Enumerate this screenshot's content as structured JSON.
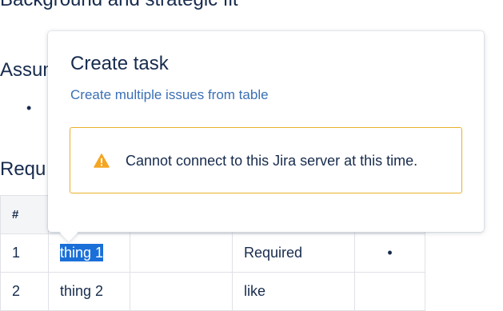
{
  "document": {
    "headings": {
      "background": "Background and strategic fit",
      "assumptions": "Assum",
      "requirements": "Requ"
    },
    "assumptions_bullet": "•",
    "table": {
      "header": [
        "#",
        "",
        "",
        "",
        ""
      ],
      "rows": [
        {
          "num": "1",
          "title": "thing 1",
          "col3": "",
          "priority": "Required",
          "notes": "•"
        },
        {
          "num": "2",
          "title": "thing 2",
          "col3": "",
          "priority": "like",
          "notes": ""
        }
      ]
    }
  },
  "popup": {
    "title": "Create task",
    "link": "Create multiple issues from table",
    "warning": {
      "icon": "warning-icon",
      "message": "Cannot connect to this Jira server at this time.",
      "border_color": "#e8b12b",
      "icon_color": "#f5a623"
    }
  },
  "colors": {
    "text": "#172b4d",
    "link": "#3b6fb6",
    "selection": "#1a6fd8"
  }
}
